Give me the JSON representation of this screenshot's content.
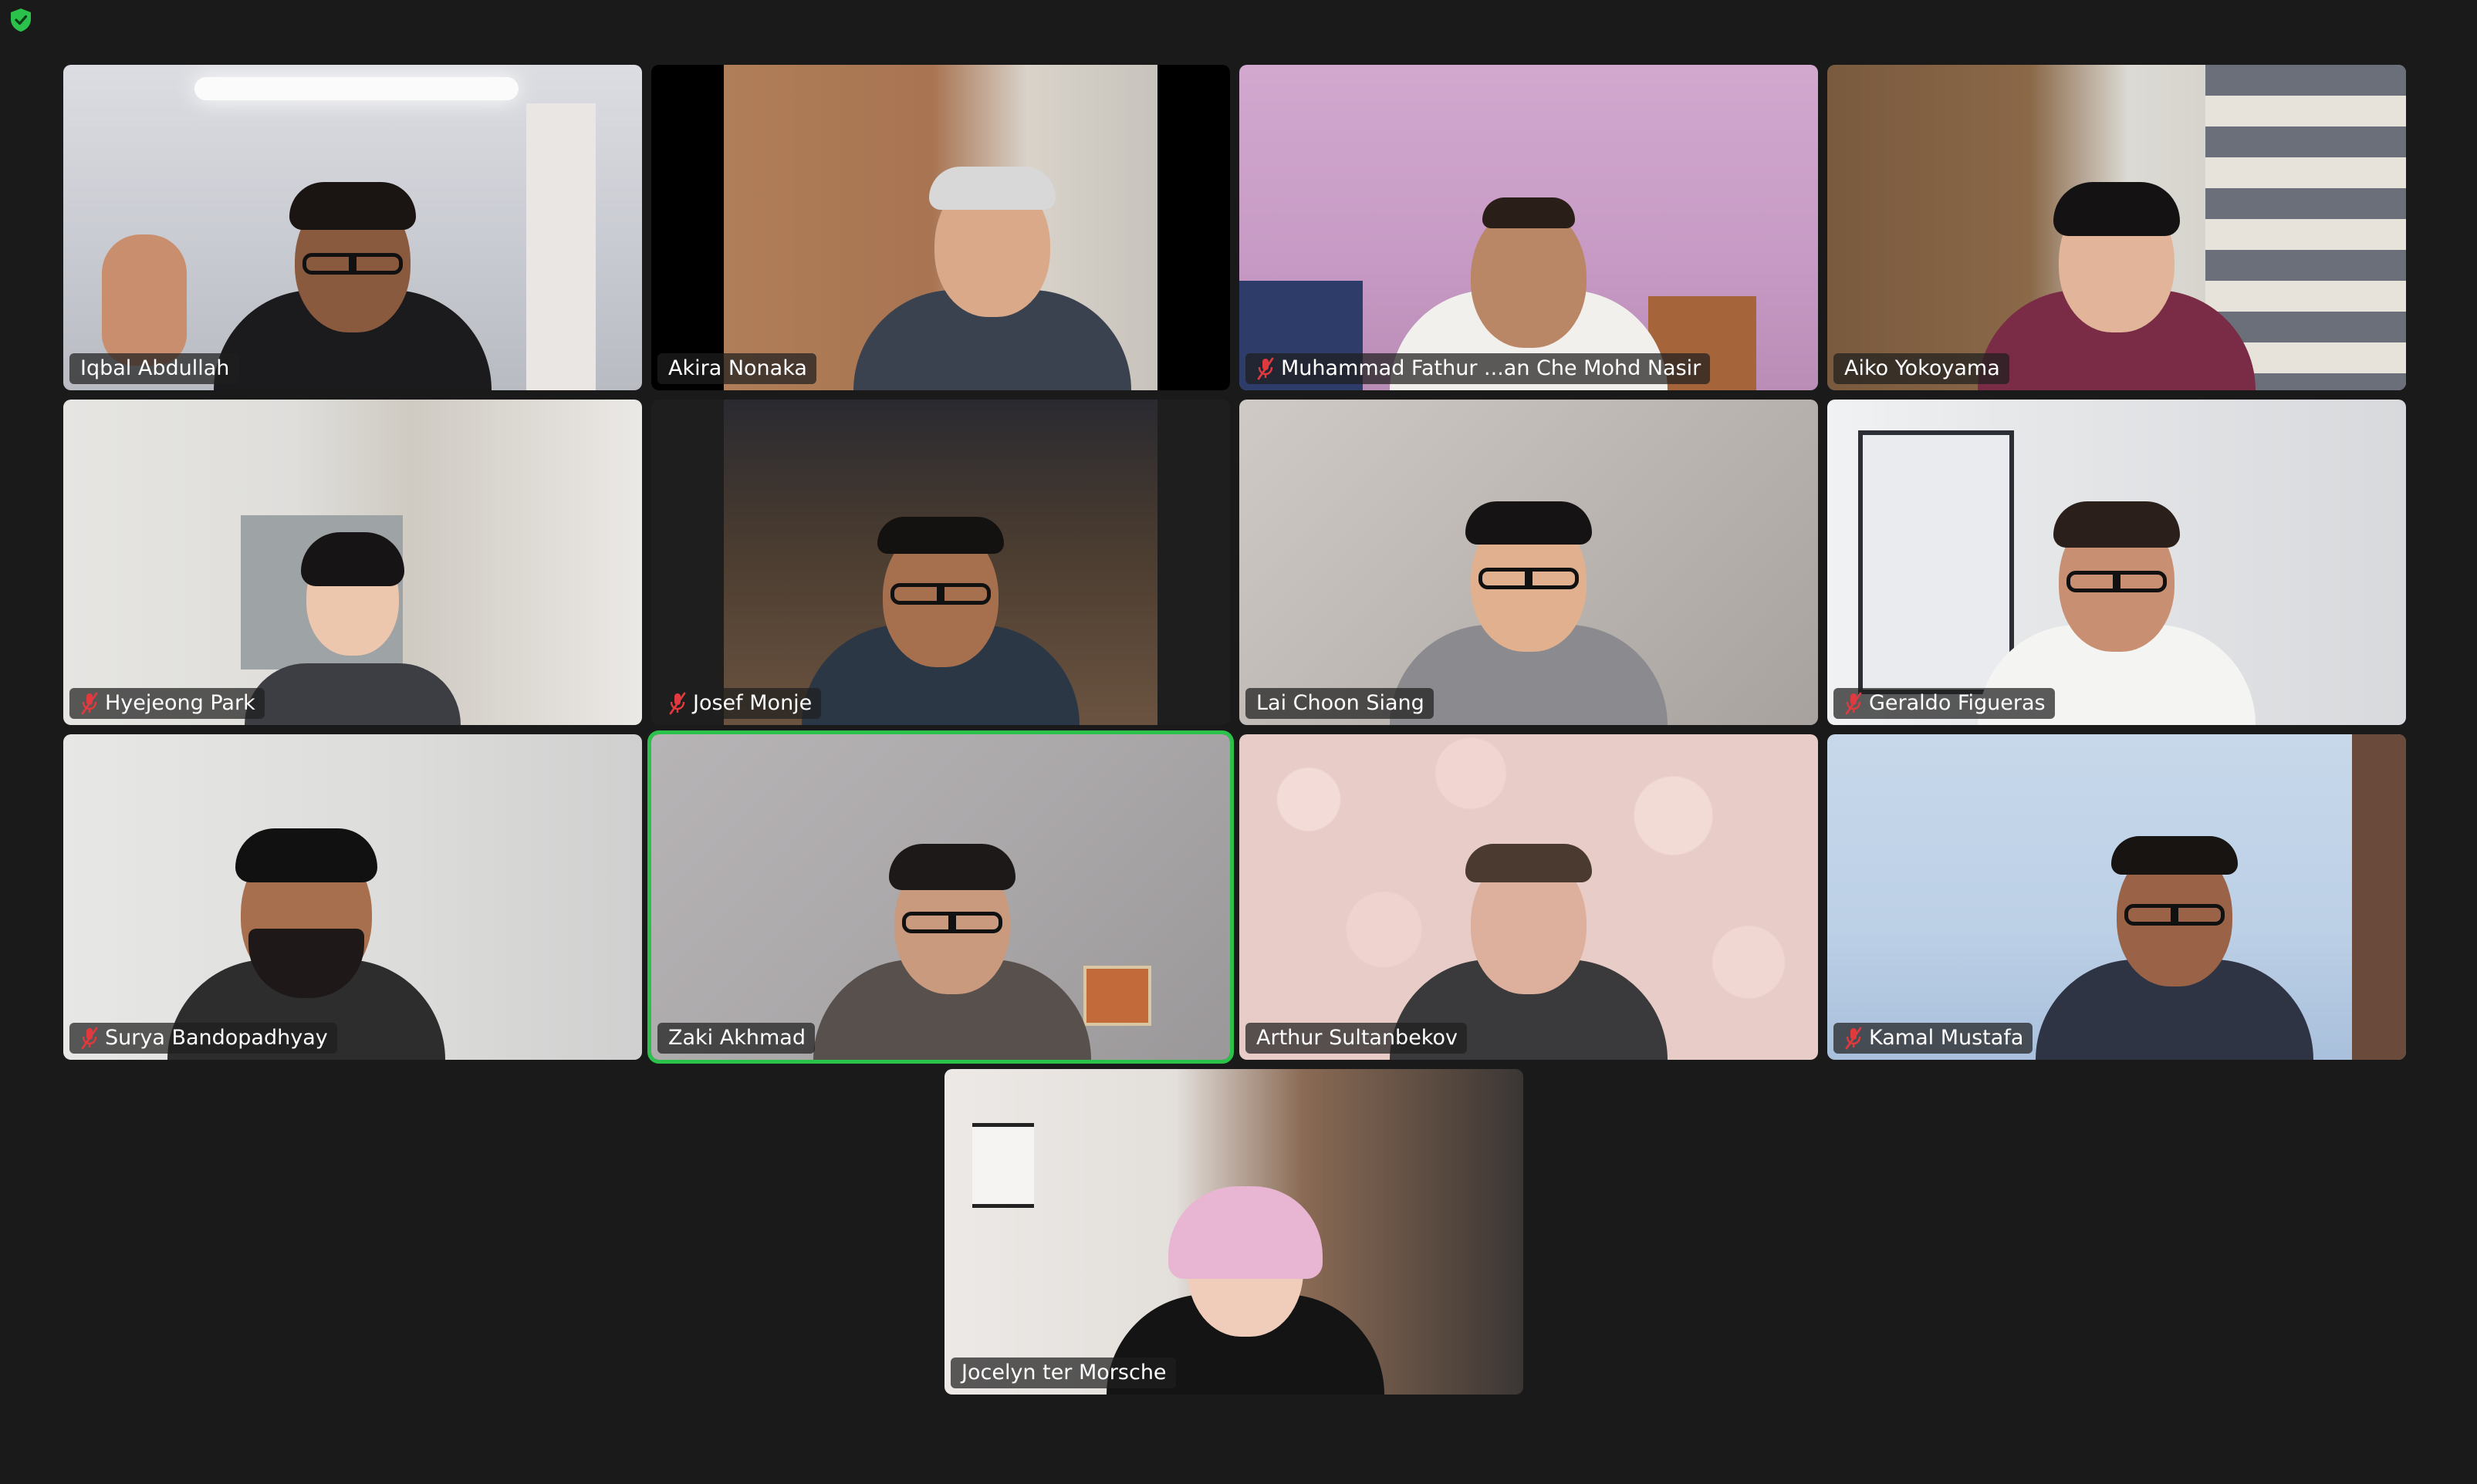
{
  "meeting": {
    "security_icon": "shield-check-icon",
    "accent_color": "#2ac24a",
    "muted_color": "#e0393e",
    "background": "#1a1a1a"
  },
  "participants": [
    {
      "name": "Iqbal Abdullah",
      "muted": false,
      "active_speaker": false
    },
    {
      "name": "Akira Nonaka",
      "muted": false,
      "active_speaker": false
    },
    {
      "name": "Muhammad Fathur ...an Che Mohd Nasir",
      "muted": true,
      "active_speaker": false
    },
    {
      "name": "Aiko Yokoyama",
      "muted": false,
      "active_speaker": false
    },
    {
      "name": "Hyejeong Park",
      "muted": true,
      "active_speaker": false
    },
    {
      "name": "Josef Monje",
      "muted": true,
      "active_speaker": false
    },
    {
      "name": "Lai Choon Siang",
      "muted": false,
      "active_speaker": false
    },
    {
      "name": "Geraldo Figueras",
      "muted": true,
      "active_speaker": false
    },
    {
      "name": "Surya Bandopadhyay",
      "muted": true,
      "active_speaker": false
    },
    {
      "name": "Zaki Akhmad",
      "muted": false,
      "active_speaker": true
    },
    {
      "name": "Arthur Sultanbekov",
      "muted": false,
      "active_speaker": false
    },
    {
      "name": "Kamal Mustafa",
      "muted": true,
      "active_speaker": false
    },
    {
      "name": "Jocelyn ter Morsche",
      "muted": false,
      "active_speaker": false
    }
  ]
}
